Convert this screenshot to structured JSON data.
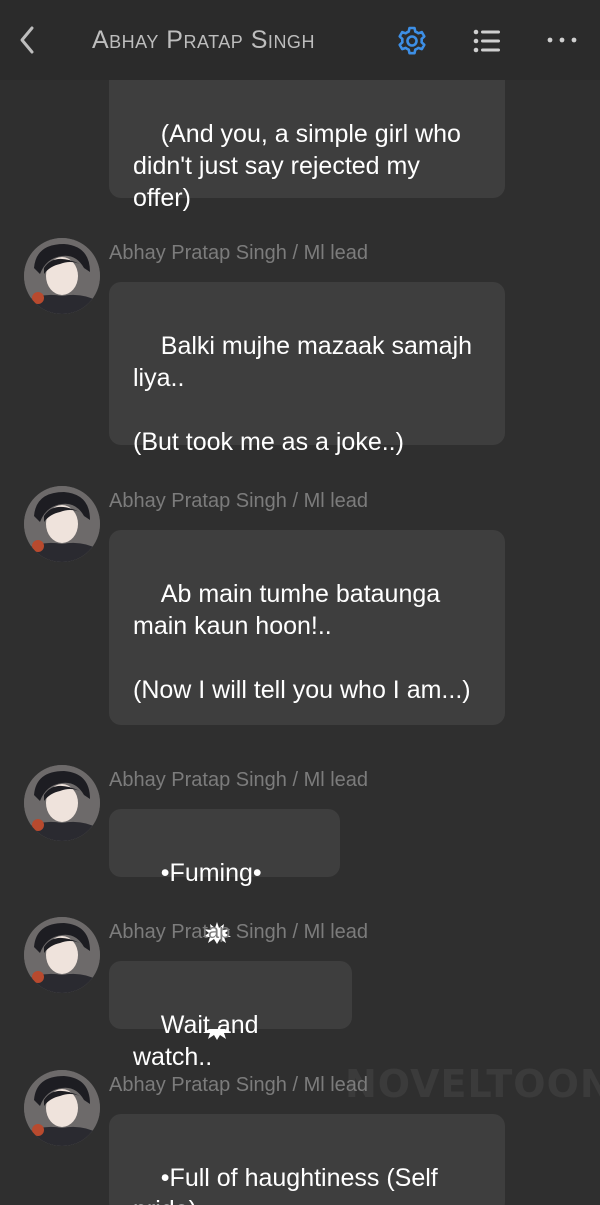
{
  "header": {
    "title": "Abhay Pratap Singh",
    "icons": [
      "back-icon",
      "gear-icon",
      "list-icon",
      "more-icon"
    ],
    "accent_color": "#3d8fe6"
  },
  "messages": [
    {
      "text": "(And you, a simple girl who didn't just say rejected my offer)"
    },
    {
      "sender": "Abhay Pratap Singh / Ml lead",
      "text": "Balki mujhe mazaak samajh liya..\n\n(But took me as a joke..)"
    },
    {
      "sender": "Abhay Pratap Singh / Ml lead",
      "text": "Ab main tumhe bataunga main kaun hoon!..\n\n(Now I will tell you who I am...)"
    },
    {
      "sender": "Abhay Pratap Singh / Ml lead",
      "text": "•Fuming•"
    },
    {
      "sender": "Abhay Pratap Singh / Ml lead",
      "text": "Wait and watch.."
    },
    {
      "sender": "Abhay Pratap Singh / Ml lead",
      "text": "•Full of haughtiness (Self pride)•"
    }
  ],
  "watermark": "NOVELTOON"
}
